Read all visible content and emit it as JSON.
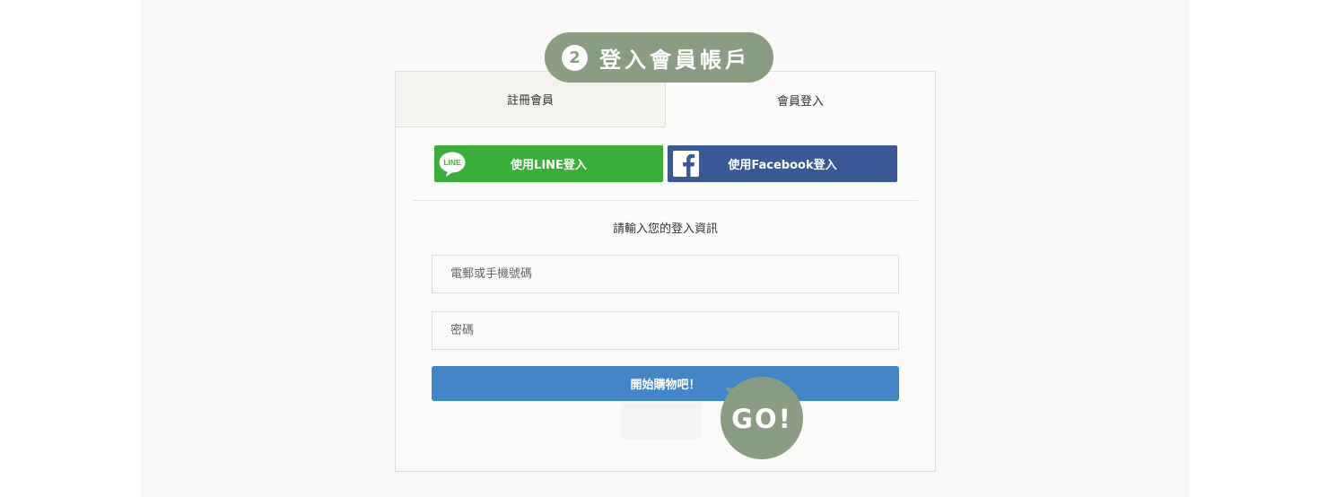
{
  "step_banner": {
    "number": "2",
    "title": "登入會員帳戶"
  },
  "tabs": [
    {
      "label": "註冊會員",
      "active": false
    },
    {
      "label": "會員登入",
      "active": true
    }
  ],
  "social": {
    "line_label": "使用LINE登入",
    "line_logo_text": "LINE",
    "facebook_label": "使用Facebook登入",
    "line_color": "#3aae3b",
    "facebook_color": "#3b5896"
  },
  "form": {
    "prompt": "請輸入您的登入資訊",
    "account_placeholder": "電郵或手機號碼",
    "password_placeholder": "密碼",
    "submit_label": "開始購物吧！",
    "submit_color": "#4386c8"
  },
  "go_badge": {
    "text": "GO!"
  },
  "icons": {
    "line": "line-logo-icon",
    "facebook": "facebook-logo-icon"
  }
}
